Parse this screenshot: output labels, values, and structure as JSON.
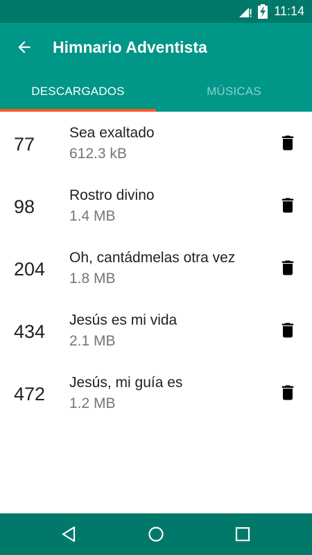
{
  "status_bar": {
    "time": "11:14",
    "icons": [
      "signal-icon",
      "battery-charging-icon"
    ]
  },
  "app_bar": {
    "title": "Himnario Adventista",
    "back_icon": "arrow-back-icon"
  },
  "tabs": [
    {
      "label": "DESCARGADOS",
      "selected": true
    },
    {
      "label": "MÚSICAS",
      "selected": false
    }
  ],
  "colors": {
    "status_bar": "#00796b",
    "primary": "#009688",
    "tab_indicator": "#ff5722",
    "nav_bar": "#00796b"
  },
  "hymns": [
    {
      "number": "77",
      "title": "Sea exaltado",
      "size": "612.3 kB"
    },
    {
      "number": "98",
      "title": "Rostro divino",
      "size": "1.4 MB"
    },
    {
      "number": "204",
      "title": "Oh, cantádmelas otra vez",
      "size": "1.8 MB"
    },
    {
      "number": "434",
      "title": "Jesús es mi vida",
      "size": "2.1 MB"
    },
    {
      "number": "472",
      "title": "Jesús, mi guía es",
      "size": "1.2 MB"
    }
  ],
  "row_action_icon": "delete-icon",
  "nav_bar": {
    "icons": [
      "nav-back-icon",
      "nav-home-icon",
      "nav-recents-icon"
    ]
  }
}
